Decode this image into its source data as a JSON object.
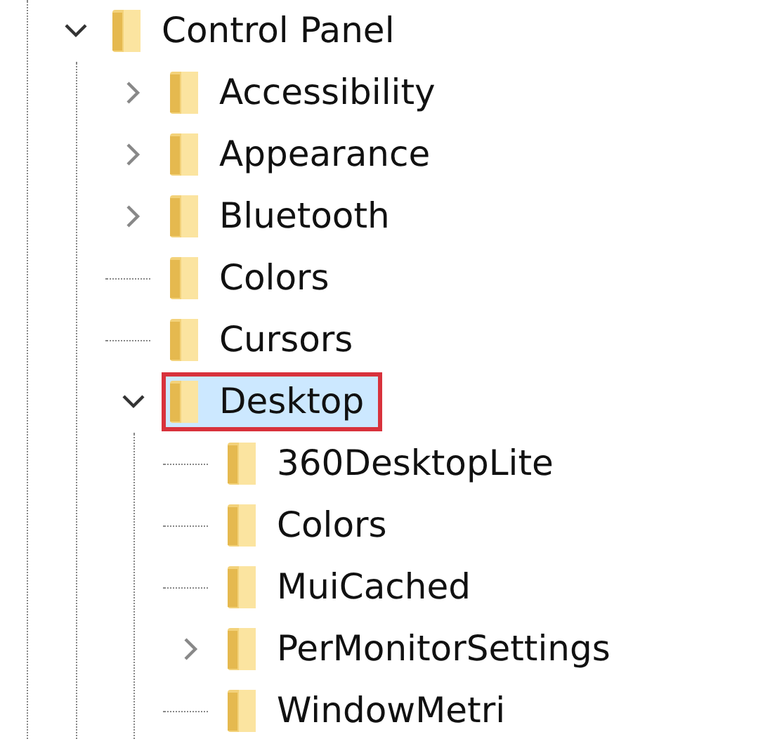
{
  "tree": [
    {
      "label": "Control Panel",
      "kind": "branch",
      "expanded": true,
      "selected": false,
      "children": [
        {
          "label": "Accessibility",
          "kind": "branch",
          "expanded": false,
          "selected": false
        },
        {
          "label": "Appearance",
          "kind": "branch",
          "expanded": false,
          "selected": false
        },
        {
          "label": "Bluetooth",
          "kind": "branch",
          "expanded": false,
          "selected": false
        },
        {
          "label": "Colors",
          "kind": "leaf",
          "selected": false
        },
        {
          "label": "Cursors",
          "kind": "leaf",
          "selected": false
        },
        {
          "label": "Desktop",
          "kind": "branch",
          "expanded": true,
          "selected": true,
          "children": [
            {
              "label": "360DesktopLite",
              "kind": "leaf",
              "selected": false
            },
            {
              "label": "Colors",
              "kind": "leaf",
              "selected": false
            },
            {
              "label": "MuiCached",
              "kind": "leaf",
              "selected": false
            },
            {
              "label": "PerMonitorSettings",
              "kind": "branch",
              "expanded": false,
              "selected": false
            },
            {
              "label": "WindowMetri",
              "kind": "leaf",
              "selected": false
            }
          ]
        }
      ]
    }
  ]
}
